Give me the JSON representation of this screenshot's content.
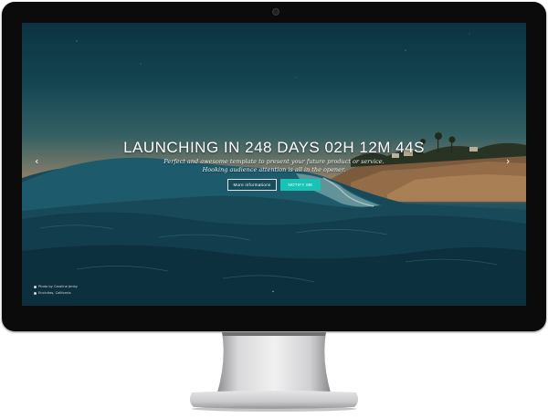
{
  "hero": {
    "headline": "LAUNCHING IN 248 DAYS 02H 12M 44S",
    "tagline_line1": "Perfect and awesome template to present your future product or service.",
    "tagline_line2": "Hooking audience attention is all in the opener."
  },
  "buttons": {
    "more_info": "More informations",
    "notify_me": "NOTIFY ME"
  },
  "carousel": {
    "prev_glyph": "‹",
    "next_glyph": "›"
  },
  "credits": {
    "photo": "Photo by Caraline Jenby",
    "location": "Encinitas, California"
  },
  "icons": {
    "scroll_indicator": "chevron-down-icon"
  },
  "colors": {
    "accent": "#16c3b4",
    "bezel": "#0b0b0c"
  }
}
